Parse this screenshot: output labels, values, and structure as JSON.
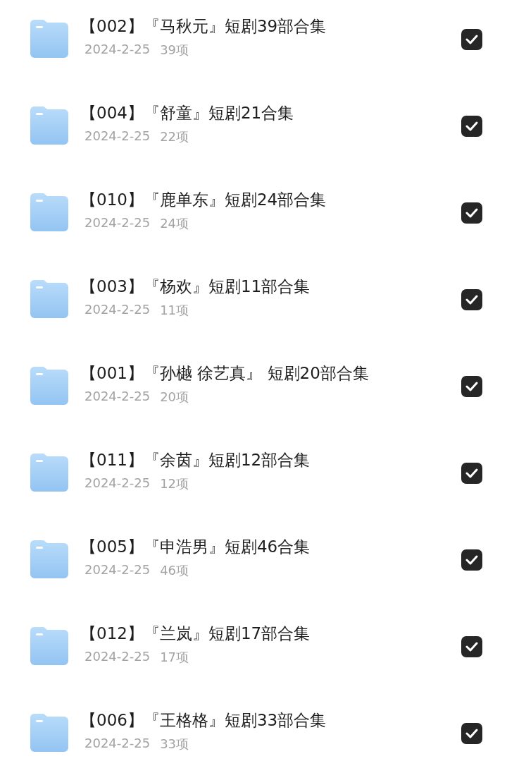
{
  "folders": [
    {
      "name": "【002】『马秋元』短剧39部合集",
      "date": "2024-2-25",
      "count": "39项",
      "checked": true
    },
    {
      "name": "【004】『舒童』短剧21合集",
      "date": "2024-2-25",
      "count": "22项",
      "checked": true
    },
    {
      "name": "【010】『鹿单东』短剧24部合集",
      "date": "2024-2-25",
      "count": "24项",
      "checked": true
    },
    {
      "name": "【003】『杨欢』短剧11部合集",
      "date": "2024-2-25",
      "count": "11项",
      "checked": true
    },
    {
      "name": "【001】『孙樾 徐艺真』 短剧20部合集",
      "date": "2024-2-25",
      "count": "20项",
      "checked": true
    },
    {
      "name": "【011】『余茵』短剧12部合集",
      "date": "2024-2-25",
      "count": "12项",
      "checked": true
    },
    {
      "name": "【005】『申浩男』短剧46合集",
      "date": "2024-2-25",
      "count": "46项",
      "checked": true
    },
    {
      "name": "【012】『兰岚』短剧17部合集",
      "date": "2024-2-25",
      "count": "17项",
      "checked": true
    },
    {
      "name": "【006】『王格格』短剧33部合集",
      "date": "2024-2-25",
      "count": "33项",
      "checked": true
    }
  ]
}
